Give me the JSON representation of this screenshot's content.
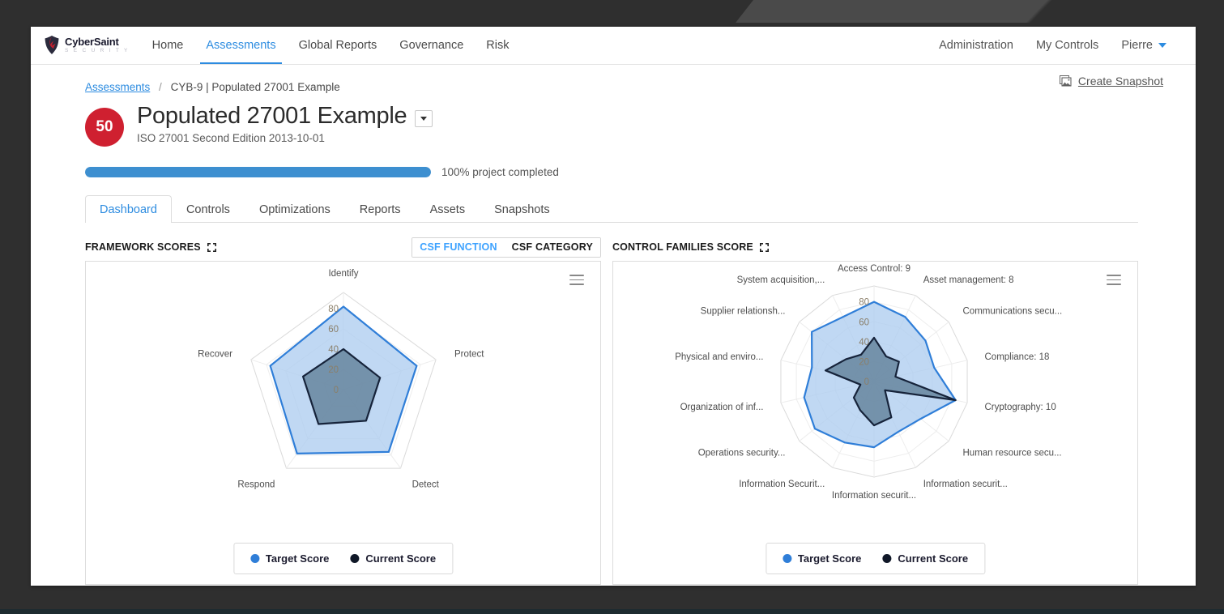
{
  "app": {
    "brand_name": "CyberSaint",
    "brand_sub": "S E C U R I T Y"
  },
  "topnav": {
    "left_items": [
      {
        "label": "Home",
        "active": false
      },
      {
        "label": "Assessments",
        "active": true
      },
      {
        "label": "Global Reports",
        "active": false
      },
      {
        "label": "Governance",
        "active": false
      },
      {
        "label": "Risk",
        "active": false
      }
    ],
    "right_items": [
      {
        "label": "Administration"
      },
      {
        "label": "My Controls"
      },
      {
        "label": "Pierre"
      }
    ]
  },
  "breadcrumb": {
    "root": "Assessments",
    "separator": "/",
    "current": "CYB-9 | Populated 27001 Example"
  },
  "header": {
    "score": "50",
    "title": "Populated 27001 Example",
    "subtitle": "ISO 27001 Second Edition 2013-10-01",
    "snapshot_label": "Create Snapshot"
  },
  "progress": {
    "percent": 100,
    "label": "100% project completed"
  },
  "tabs": [
    {
      "label": "Dashboard",
      "active": true
    },
    {
      "label": "Controls",
      "active": false
    },
    {
      "label": "Optimizations",
      "active": false
    },
    {
      "label": "Reports",
      "active": false
    },
    {
      "label": "Assets",
      "active": false
    },
    {
      "label": "Snapshots",
      "active": false
    }
  ],
  "panels": {
    "left": {
      "title": "FRAMEWORK SCORES",
      "toggle": [
        {
          "label": "CSF FUNCTION",
          "active": true
        },
        {
          "label": "CSF CATEGORY",
          "active": false
        }
      ]
    },
    "right": {
      "title": "CONTROL FAMILIES SCORE"
    }
  },
  "legend": {
    "target": {
      "label": "Target Score",
      "color": "#2f7ed8"
    },
    "current": {
      "label": "Current Score",
      "color": "#101828"
    }
  },
  "colors": {
    "accent_blue": "#2d8ce0",
    "badge_red": "#cf2030",
    "target_fill": "#aecdf0",
    "target_stroke": "#2f7ed8",
    "current_fill": "#5f7d96",
    "current_stroke": "#16233a",
    "progress_bar": "#3d8fd0"
  },
  "chart_data": [
    {
      "id": "framework-scores-radar",
      "type": "radar",
      "title": "FRAMEWORK SCORES",
      "categories": [
        "Identify",
        "Protect",
        "Detect",
        "Respond",
        "Recover"
      ],
      "tick_labels": [
        "0",
        "20",
        "40",
        "60",
        "80"
      ],
      "rlim": [
        0,
        96
      ],
      "grid": true,
      "legend_position": "bottom",
      "series": [
        {
          "name": "Target Score",
          "color": "#2f7ed8",
          "values": [
            82,
            76,
            76,
            78,
            76
          ]
        },
        {
          "name": "Current Score",
          "color": "#101828",
          "values": [
            40,
            38,
            38,
            42,
            42
          ]
        }
      ]
    },
    {
      "id": "control-families-radar",
      "type": "radar",
      "title": "CONTROL FAMILIES SCORE",
      "categories": [
        "Access Control: 9",
        "Asset management: 8",
        "Communications secu...",
        "Compliance: 18",
        "Cryptography: 10",
        "Human resource secu...",
        "Information securit...",
        "Information securit...",
        "Information Securit...",
        "Operations security...",
        "Organization of inf...",
        "Physical and enviro...",
        "Supplier relationsh...",
        "System acquisition,..."
      ],
      "tick_labels": [
        "0",
        "20",
        "40",
        "60",
        "80"
      ],
      "rlim": [
        0,
        96
      ],
      "grid": true,
      "legend_position": "bottom",
      "series": [
        {
          "name": "Target Score",
          "color": "#2f7ed8",
          "values": [
            80,
            72,
            66,
            62,
            84,
            60,
            56,
            66,
            68,
            76,
            72,
            64,
            80,
            72
          ]
        },
        {
          "name": "Current Score",
          "color": "#101828",
          "values": [
            44,
            28,
            32,
            22,
            84,
            14,
            40,
            44,
            32,
            26,
            14,
            50,
            36,
            30
          ]
        }
      ]
    }
  ],
  "icons": {
    "snapshot": "image-icon",
    "expand": "expand-icon",
    "menu": "hamburger-menu-icon",
    "caret": "chevron-down-icon"
  }
}
